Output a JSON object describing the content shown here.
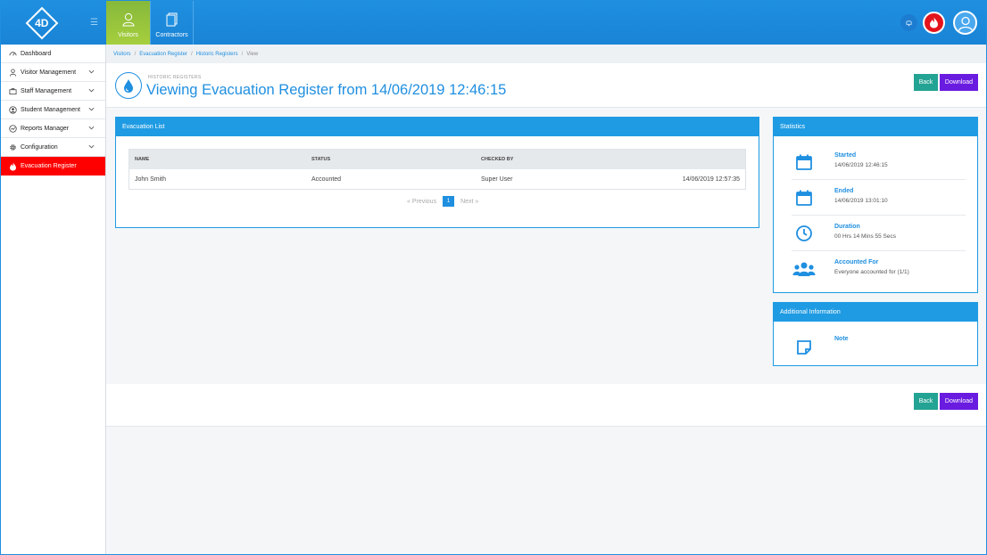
{
  "app": {
    "logo_text": "4D"
  },
  "topnav": {
    "tabs": [
      {
        "label": "Visitors",
        "icon": "person-icon",
        "active": true
      },
      {
        "label": "Contractors",
        "icon": "document-icon",
        "active": false
      }
    ]
  },
  "sidebar": {
    "items": [
      {
        "label": "Dashboard",
        "icon": "dashboard-icon"
      },
      {
        "label": "Visitor Management",
        "icon": "person-icon"
      },
      {
        "label": "Staff Management",
        "icon": "staff-icon"
      },
      {
        "label": "Student Management",
        "icon": "student-icon"
      },
      {
        "label": "Reports Manager",
        "icon": "reports-icon"
      },
      {
        "label": "Configuration",
        "icon": "gear-icon"
      },
      {
        "label": "Evacuation Register",
        "icon": "flame-icon",
        "active": true
      }
    ]
  },
  "breadcrumb": [
    "Visitors",
    "Evacuation Register",
    "Historic Registers",
    "View"
  ],
  "header": {
    "subtitle": "HISTORIC REGISTERS",
    "title": "Viewing Evacuation Register from 14/06/2019 12:46:15"
  },
  "buttons": {
    "back": "Back",
    "download": "Download"
  },
  "evac_list": {
    "title": "Evacuation List",
    "columns": [
      "NAME",
      "STATUS",
      "CHECKED BY",
      ""
    ],
    "rows": [
      [
        "John Smith",
        "Accounted",
        "Super User",
        "14/06/2019 12:57:35"
      ]
    ],
    "pager": {
      "prev": "Previous",
      "page": "1",
      "next": "Next"
    }
  },
  "statistics": {
    "title": "Statistics",
    "items": [
      {
        "label": "Started",
        "value": "14/06/2019 12:46:15",
        "icon": "calendar-icon"
      },
      {
        "label": "Ended",
        "value": "14/06/2019 13:01:10",
        "icon": "calendar-icon"
      },
      {
        "label": "Duration",
        "value": "00 Hrs 14 Mins 55 Secs",
        "icon": "clock-icon"
      },
      {
        "label": "Accounted For",
        "value": "Everyone accounted for (1/1)",
        "icon": "group-icon"
      }
    ]
  },
  "additional": {
    "title": "Additional Information",
    "note_label": "Note"
  },
  "colors": {
    "primary": "#1f8fe0",
    "active_tab": "#a6cf3d",
    "danger": "#ff0000",
    "back_btn": "#23a393",
    "download_btn": "#6a1be0"
  }
}
